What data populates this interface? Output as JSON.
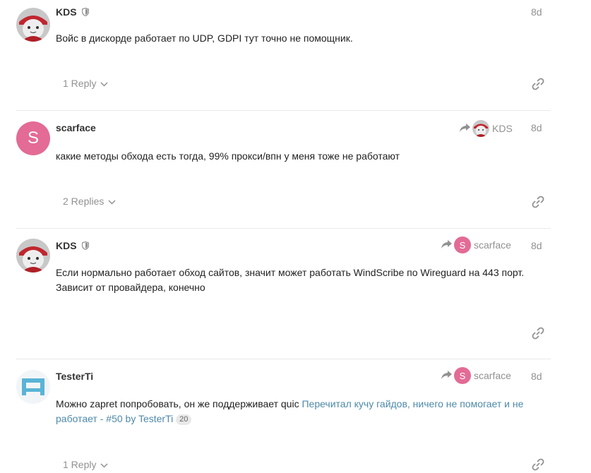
{
  "posts": [
    {
      "username": "KDS",
      "date": "8d",
      "text": "Войс в дискорде работает по UDP, GDPI тут точно не помощник.",
      "replies_label": "1 Reply",
      "avatar": "red-hat-cat-photo"
    },
    {
      "username": "scarface",
      "avatar_letter": "S",
      "avatar_color": "#e36b95",
      "reply_to": "KDS",
      "date": "8d",
      "text": "какие методы обхода есть тогда, 99% прокси/впн у меня тоже не работают",
      "replies_label": "2 Replies"
    },
    {
      "username": "KDS",
      "reply_to": "scarface",
      "reply_to_letter": "S",
      "date": "8d",
      "text_line1": "Если нормально работает обход сайтов, значит может работать WindScribe по Wireguard на 443 порт.",
      "text_line2": "Зависит от провайдера, конечно",
      "avatar": "red-hat-cat-photo"
    },
    {
      "username": "TesterTi",
      "reply_to": "scarface",
      "reply_to_letter": "S",
      "date": "8d",
      "text_prefix": "Можно zapret попробовать, он же поддерживает quic ",
      "link_text": "Перечитал кучу гайдов, ничего не помогает и не работает - #50 by TesterTi",
      "link_badge": "20",
      "replies_label": "1 Reply",
      "avatar": "blue-geometric-identicon"
    }
  ],
  "colors": {
    "accent_link": "#4d8aa9",
    "muted": "#919191",
    "scarface_avatar": "#e36b95"
  },
  "icons": [
    "shield-icon",
    "share-arrow-icon",
    "chevron-down-icon",
    "link-icon"
  ]
}
